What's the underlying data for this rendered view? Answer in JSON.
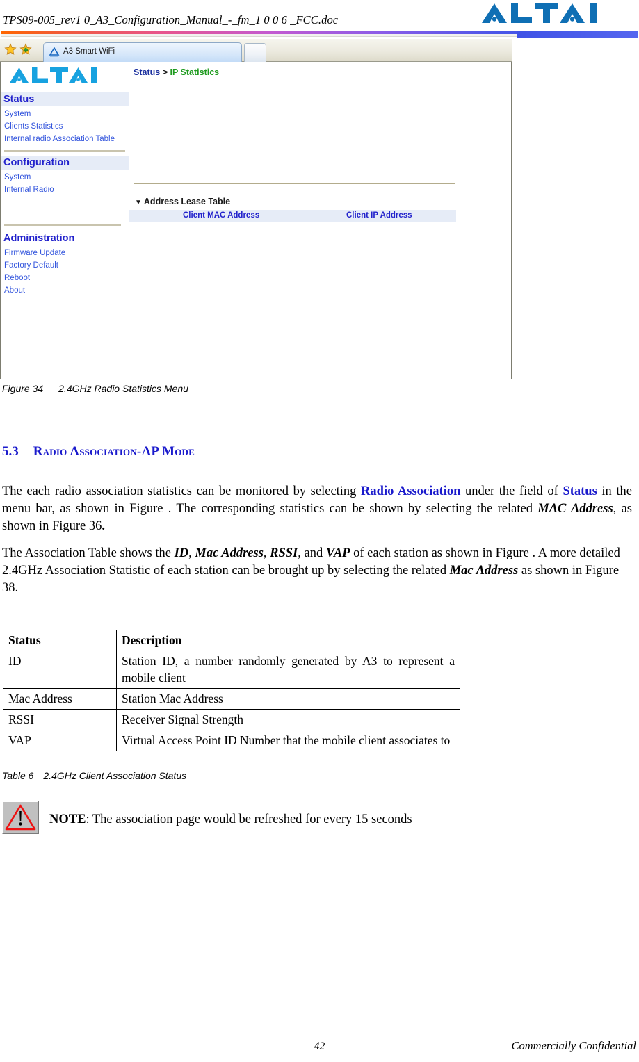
{
  "header": {
    "doc_title": "TPS09-005_rev1 0_A3_Configuration_Manual_-_fm_1 0 0 6 _FCC.doc",
    "brand": "ALTAI",
    "brand_color": "#0f6fb4",
    "rule_gradient_start": "#ff6600",
    "rule_gradient_end": "#3a50e8"
  },
  "browser": {
    "favorites_icon": "star-icon",
    "add_favorite_icon": "star-plus-icon",
    "tab": {
      "icon": "altai-triangle-icon",
      "title": "A3 Smart WiFi"
    },
    "new_tab_label": ""
  },
  "webui": {
    "logo": "ALTAI",
    "breadcrumb": {
      "root": "Status",
      "separator": ">",
      "leaf": "IP Statistics",
      "root_color": "#1a2f9e",
      "leaf_color": "#1f9b1f"
    },
    "sidebar": {
      "groups": [
        {
          "title": "Status",
          "items": [
            "System",
            "Clients Statistics",
            "Internal radio Association Table"
          ]
        },
        {
          "title": "Configuration",
          "items": [
            "System",
            "Internal Radio"
          ]
        },
        {
          "title": "Administration",
          "items": [
            "Firmware Update",
            "Factory Default",
            "Reboot",
            "About"
          ]
        }
      ],
      "link_color": "#3355dd",
      "group_title_color": "#2222cc",
      "group_title_bg": "#e6ecf7"
    },
    "content": {
      "section_caret": "caret-down-icon",
      "section_title": "Address Lease Table",
      "table": {
        "columns": [
          "Client MAC Address",
          "Client IP Address"
        ],
        "rows": [],
        "header_bg": "#e6ecf7",
        "header_color": "#2222cc"
      }
    }
  },
  "figure": {
    "number": "Figure 34",
    "caption": "2.4GHz Radio Statistics Menu"
  },
  "section": {
    "number": "5.3",
    "title": "Radio Association-AP Mode",
    "title_color": "#1a1acc"
  },
  "paragraphs": {
    "p1": {
      "t1": "The each radio association statistics can be monitored by selecting ",
      "b1": "Radio Association",
      "t2": " under the field of ",
      "b2": "Status",
      "t3": " in the menu bar, as shown in Figure .   The corresponding statistics can be shown by selecting the related ",
      "i1": "MAC Address",
      "t4": ", as shown in Figure 36",
      "t5": "."
    },
    "p2": {
      "t1": "The Association Table shows the ",
      "i1": "ID",
      "t2": ", ",
      "i2": "Mac Address",
      "t3": ", ",
      "i3": "RSSI",
      "t4": ", and ",
      "i4": "VAP",
      "t5": " of each station as shown in Figure . A more detailed 2.4GHz Association Statistic of each station can be brought up by selecting the related ",
      "i5": "Mac Address",
      "t6": " as shown in Figure 38."
    }
  },
  "status_table": {
    "headers": [
      "Status",
      "Description"
    ],
    "rows": [
      [
        "ID",
        "Station ID, a number randomly generated by A3 to represent a mobile client"
      ],
      [
        "Mac Address",
        "Station Mac Address"
      ],
      [
        "RSSI",
        "Receiver Signal Strength"
      ],
      [
        "VAP",
        "Virtual Access Point ID Number that the mobile client associates to"
      ]
    ]
  },
  "table_caption": {
    "number": "Table 6",
    "caption": "2.4GHz Client Association Status"
  },
  "note": {
    "icon": "warning-triangle-icon",
    "label": "NOTE",
    "text": ": The association page would be refreshed for every 15 seconds"
  },
  "footer": {
    "page_number": "42",
    "confidential": "Commercially Confidential"
  }
}
